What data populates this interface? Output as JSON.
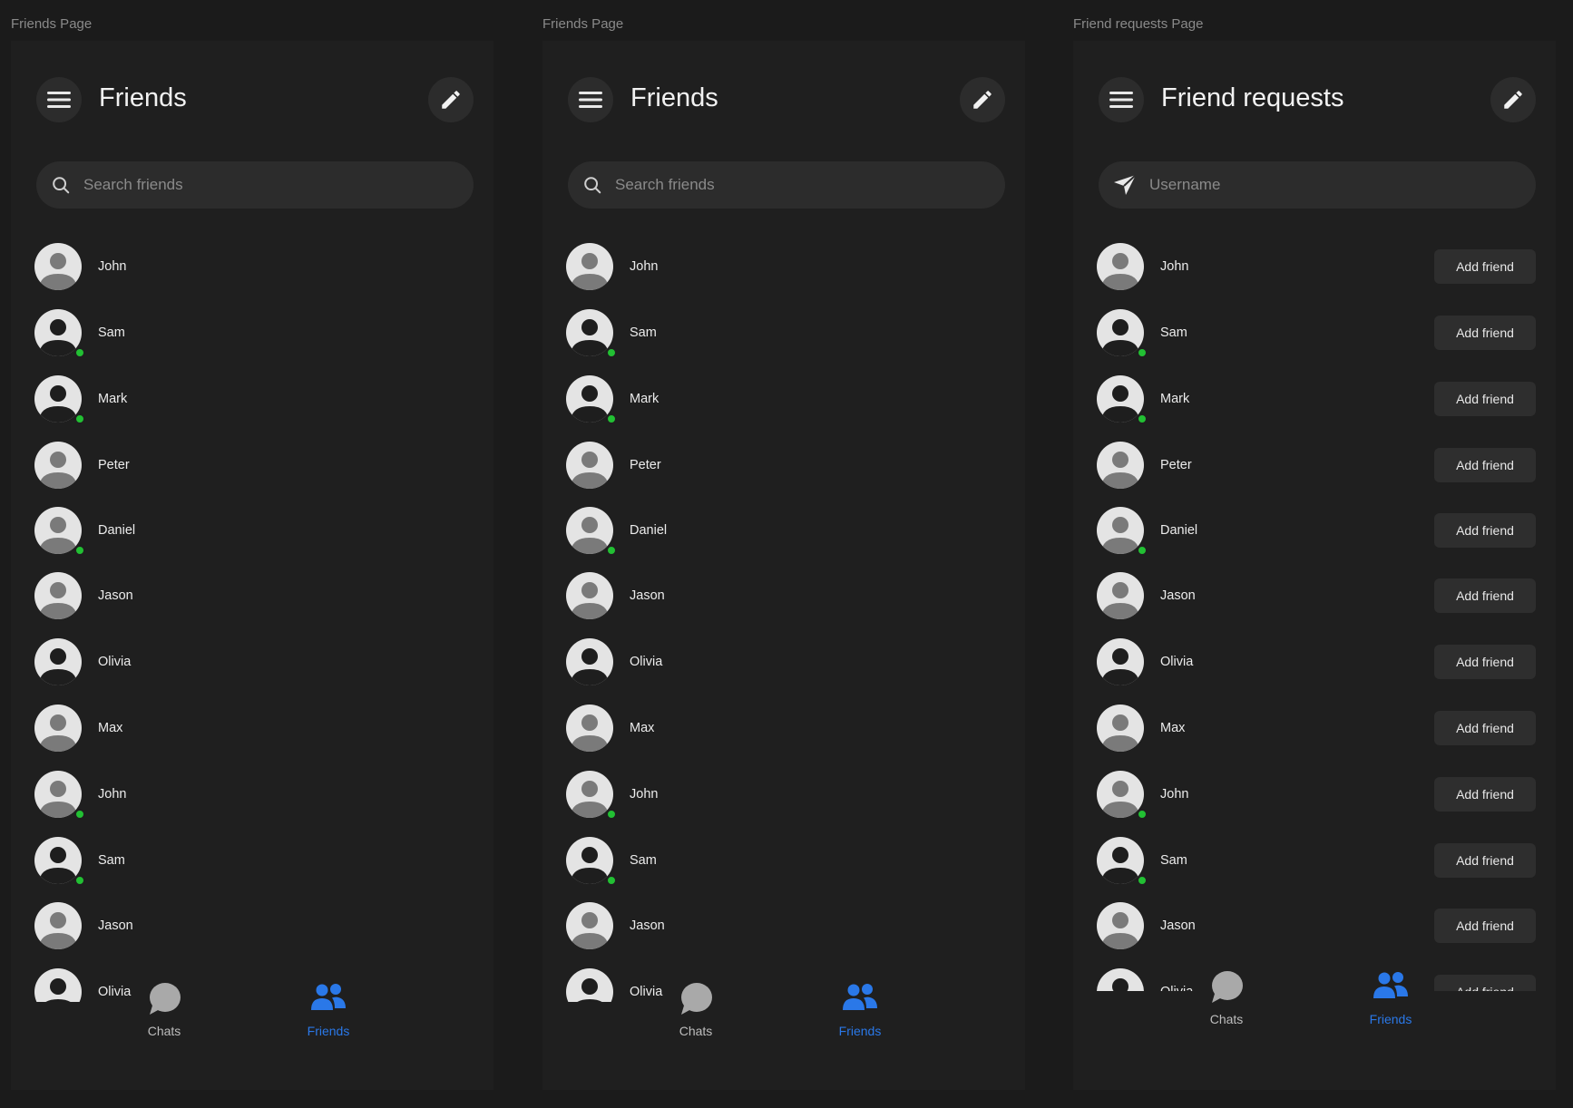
{
  "frames": [
    {
      "label": "Friends Page",
      "title": "Friends",
      "search_placeholder": "Search friends",
      "search_icon": "search-icon",
      "show_add": false,
      "nav": {
        "chats": "Chats",
        "friends": "Friends",
        "active": "friends"
      }
    },
    {
      "label": "Friends Page",
      "title": "Friends",
      "search_placeholder": "Search friends",
      "search_icon": "search-icon",
      "show_add": false,
      "nav": {
        "chats": "Chats",
        "friends": "Friends",
        "active": "friends"
      }
    },
    {
      "label": "Friend requests Page",
      "title": "Friend requests",
      "search_placeholder": "Username",
      "search_icon": "send-icon",
      "show_add": true,
      "add_label": "Add friend",
      "nav": {
        "chats": "Chats",
        "friends": "Friends",
        "active": "friends"
      }
    }
  ],
  "friends": [
    {
      "name": "John",
      "avatar": "light",
      "online": false
    },
    {
      "name": "Sam",
      "avatar": "dark",
      "online": true
    },
    {
      "name": "Mark",
      "avatar": "dark",
      "online": true
    },
    {
      "name": "Peter",
      "avatar": "light",
      "online": false
    },
    {
      "name": "Daniel",
      "avatar": "light",
      "online": true
    },
    {
      "name": "Jason",
      "avatar": "light",
      "online": false
    },
    {
      "name": "Olivia",
      "avatar": "dark",
      "online": false
    },
    {
      "name": "Max",
      "avatar": "light",
      "online": false
    },
    {
      "name": "John",
      "avatar": "light",
      "online": true
    },
    {
      "name": "Sam",
      "avatar": "dark",
      "online": true
    },
    {
      "name": "Jason",
      "avatar": "light",
      "online": false
    },
    {
      "name": "Olivia",
      "avatar": "dark",
      "online": false
    }
  ],
  "colors": {
    "background": "#1b1b1b",
    "panel": "#1f1f1f",
    "control": "#2c2c2c",
    "online": "#22c033",
    "accent": "#2a78e8"
  }
}
